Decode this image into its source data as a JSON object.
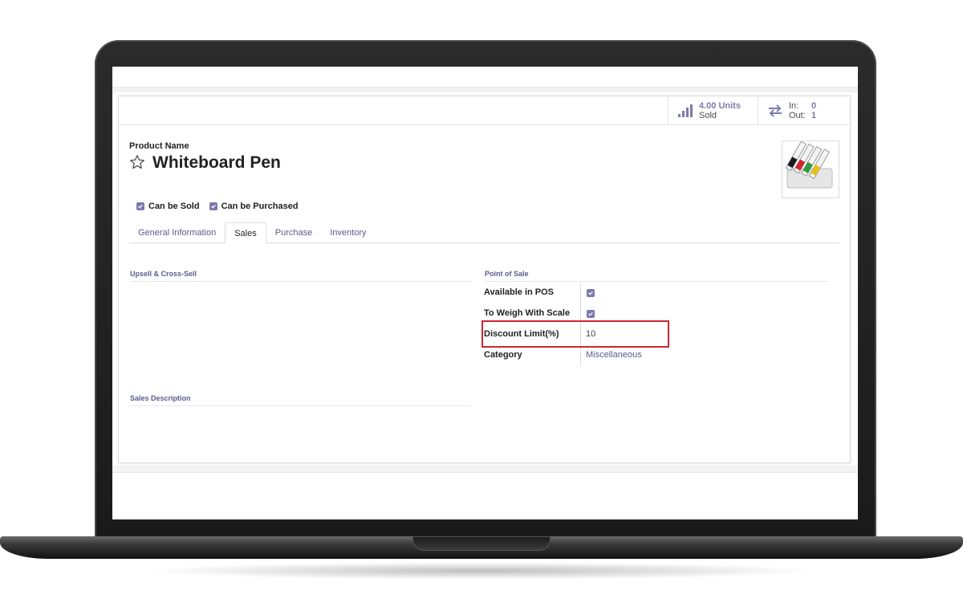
{
  "stats": {
    "sold_value": "4.00 Units",
    "sold_label": "Sold",
    "in_label": "In:",
    "in_value": "0",
    "out_label": "Out:",
    "out_value": "1"
  },
  "product": {
    "name_label": "Product Name",
    "name": "Whiteboard Pen",
    "image_icon": "whiteboard-markers-image"
  },
  "checkboxes": {
    "can_be_sold": "Can be Sold",
    "can_be_purchased": "Can be Purchased"
  },
  "tabs": [
    {
      "label": "General Information",
      "active": false
    },
    {
      "label": "Sales",
      "active": true
    },
    {
      "label": "Purchase",
      "active": false
    },
    {
      "label": "Inventory",
      "active": false
    }
  ],
  "sections": {
    "upsell": "Upsell & Cross-Sell",
    "sales_description": "Sales Description",
    "point_of_sale": "Point of Sale"
  },
  "pos_fields": {
    "available_in_pos": {
      "label": "Available in POS",
      "checked": true
    },
    "to_weigh_with_scale": {
      "label": "To Weigh With Scale",
      "checked": true
    },
    "discount_limit": {
      "label": "Discount Limit(%)",
      "value": "10"
    },
    "category": {
      "label": "Category",
      "value": "Miscellaneous"
    }
  },
  "colors": {
    "accent": "#7c7bad",
    "highlight": "#d0262d"
  }
}
